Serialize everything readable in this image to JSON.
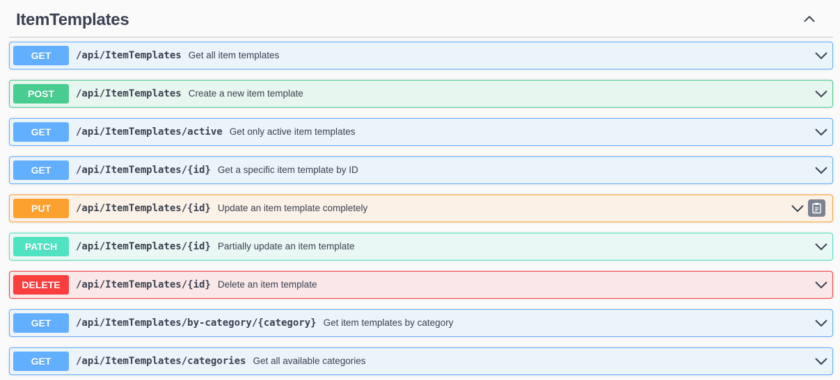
{
  "section": {
    "title": "ItemTemplates"
  },
  "colors": {
    "get": "#61affe",
    "post": "#49cc90",
    "put": "#fca130",
    "patch": "#50e3c2",
    "delete": "#f93e3e"
  },
  "operations": [
    {
      "method": "GET",
      "path": "/api/ItemTemplates",
      "summary": "Get all item templates",
      "icon": "chevron-down-icon"
    },
    {
      "method": "POST",
      "path": "/api/ItemTemplates",
      "summary": "Create a new item template",
      "icon": "chevron-down-icon"
    },
    {
      "method": "GET",
      "path": "/api/ItemTemplates/active",
      "summary": "Get only active item templates",
      "icon": "chevron-down-icon"
    },
    {
      "method": "GET",
      "path": "/api/ItemTemplates/{id}",
      "summary": "Get a specific item template by ID",
      "icon": "chevron-down-icon"
    },
    {
      "method": "PUT",
      "path": "/api/ItemTemplates/{id}",
      "summary": "Update an item template completely",
      "icon": "chevron-down-icon",
      "extra_icon": "copy-to-clipboard-icon"
    },
    {
      "method": "PATCH",
      "path": "/api/ItemTemplates/{id}",
      "summary": "Partially update an item template",
      "icon": "chevron-down-icon"
    },
    {
      "method": "DELETE",
      "path": "/api/ItemTemplates/{id}",
      "summary": "Delete an item template",
      "icon": "chevron-down-icon"
    },
    {
      "method": "GET",
      "path": "/api/ItemTemplates/by-category/{category}",
      "summary": "Get item templates by category",
      "icon": "chevron-down-icon"
    },
    {
      "method": "GET",
      "path": "/api/ItemTemplates/categories",
      "summary": "Get all available categories",
      "icon": "chevron-down-icon"
    }
  ]
}
